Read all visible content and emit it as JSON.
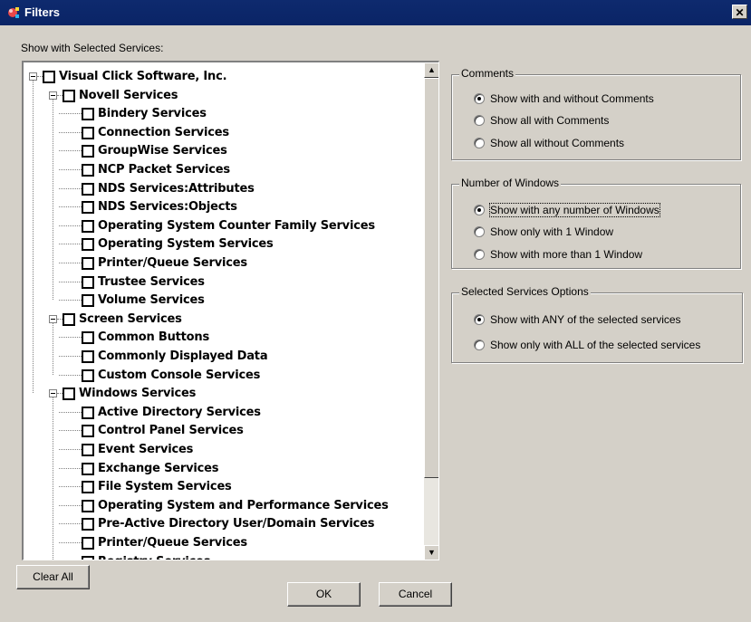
{
  "window": {
    "title": "Filters",
    "close_glyph": "✕"
  },
  "show_label": "Show with Selected Services:",
  "tree": [
    {
      "label": "Visual Click Software, Inc.",
      "level": 0,
      "expander": true
    },
    {
      "label": "Novell Services",
      "level": 1,
      "expander": true
    },
    {
      "label": "Bindery Services",
      "level": 2
    },
    {
      "label": "Connection Services",
      "level": 2
    },
    {
      "label": "GroupWise Services",
      "level": 2
    },
    {
      "label": "NCP Packet Services",
      "level": 2
    },
    {
      "label": "NDS Services:Attributes",
      "level": 2
    },
    {
      "label": "NDS Services:Objects",
      "level": 2
    },
    {
      "label": "Operating System Counter Family Services",
      "level": 2
    },
    {
      "label": "Operating System Services",
      "level": 2
    },
    {
      "label": "Printer/Queue Services",
      "level": 2
    },
    {
      "label": "Trustee Services",
      "level": 2
    },
    {
      "label": "Volume Services",
      "level": 2
    },
    {
      "label": "Screen Services",
      "level": 1,
      "expander": true
    },
    {
      "label": "Common Buttons",
      "level": 2
    },
    {
      "label": "Commonly Displayed Data",
      "level": 2
    },
    {
      "label": "Custom Console Services",
      "level": 2
    },
    {
      "label": "Windows Services",
      "level": 1,
      "expander": true
    },
    {
      "label": "Active Directory Services",
      "level": 2
    },
    {
      "label": "Control Panel Services",
      "level": 2
    },
    {
      "label": "Event Services",
      "level": 2
    },
    {
      "label": "Exchange Services",
      "level": 2
    },
    {
      "label": "File System Services",
      "level": 2
    },
    {
      "label": "Operating System and Performance Services",
      "level": 2
    },
    {
      "label": "Pre-Active Directory User/Domain Services",
      "level": 2
    },
    {
      "label": "Printer/Queue Services",
      "level": 2
    },
    {
      "label": "Registry Services",
      "level": 2
    }
  ],
  "comments": {
    "title": "Comments",
    "options": [
      "Show with and without Comments",
      "Show all with Comments",
      "Show all without Comments"
    ],
    "selected": 0
  },
  "windows": {
    "title": "Number of Windows",
    "options": [
      "Show with any number of Windows",
      "Show only with 1 Window",
      "Show with more than 1 Window"
    ],
    "selected": 0
  },
  "services_options": {
    "title": "Selected Services Options",
    "options": [
      "Show with ANY of the selected services",
      "Show only with ALL of the selected services"
    ],
    "selected": 0
  },
  "buttons": {
    "clear_all": "Clear All",
    "ok": "OK",
    "cancel": "Cancel"
  }
}
